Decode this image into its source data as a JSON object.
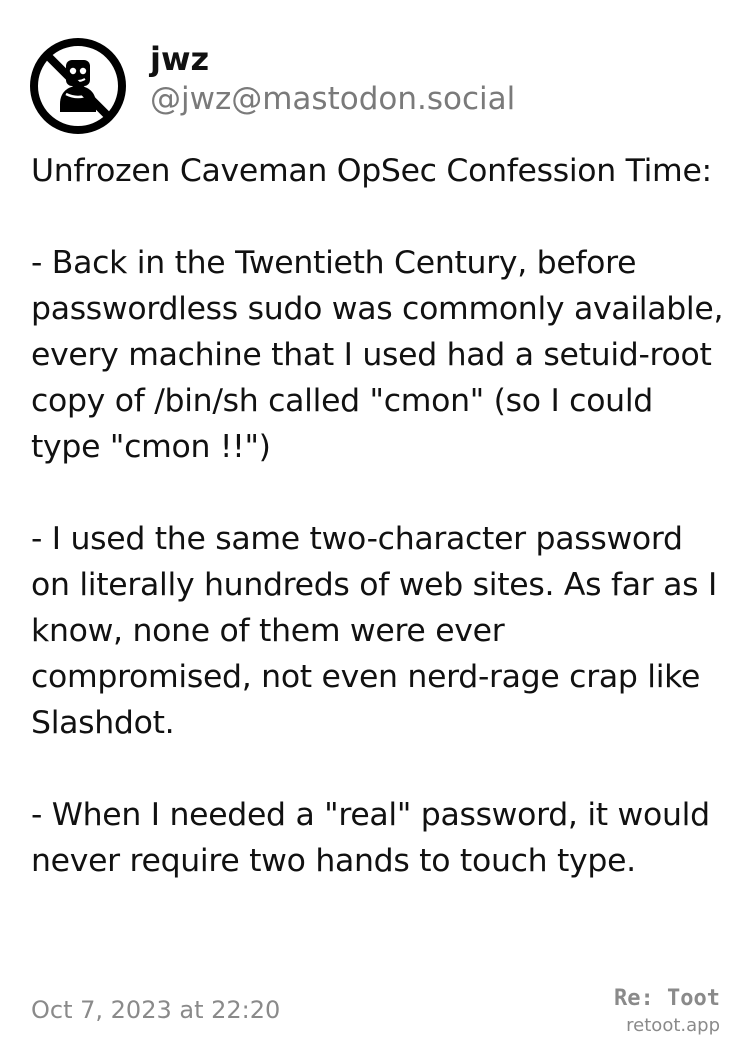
{
  "author": {
    "display_name": "jwz",
    "handle": "@jwz@mastodon.social",
    "avatar_icon": "no-symbol-over-figure-avatar-icon"
  },
  "post": {
    "body": "Unfrozen Caveman OpSec Confession Time:\n\n- Back in the Twentieth Century, before passwordless sudo was commonly available, every machine that I used had a setuid-root copy of /bin/sh called \"cmon\" (so I could type \"cmon !!\")\n\n- I used the same two-character password on literally hundreds of web sites. As far as I know, none of them were ever compromised, not even nerd-rage crap like Slashdot.\n\n- When I needed a \"real\" password, it would never require two hands to touch type.",
    "timestamp": "Oct 7, 2023 at 22:20"
  },
  "brand": {
    "name": "Re: Toot",
    "url": "retoot.app"
  },
  "colors": {
    "text": "#111111",
    "secondary": "#7a7a7a",
    "background": "#ffffff"
  }
}
